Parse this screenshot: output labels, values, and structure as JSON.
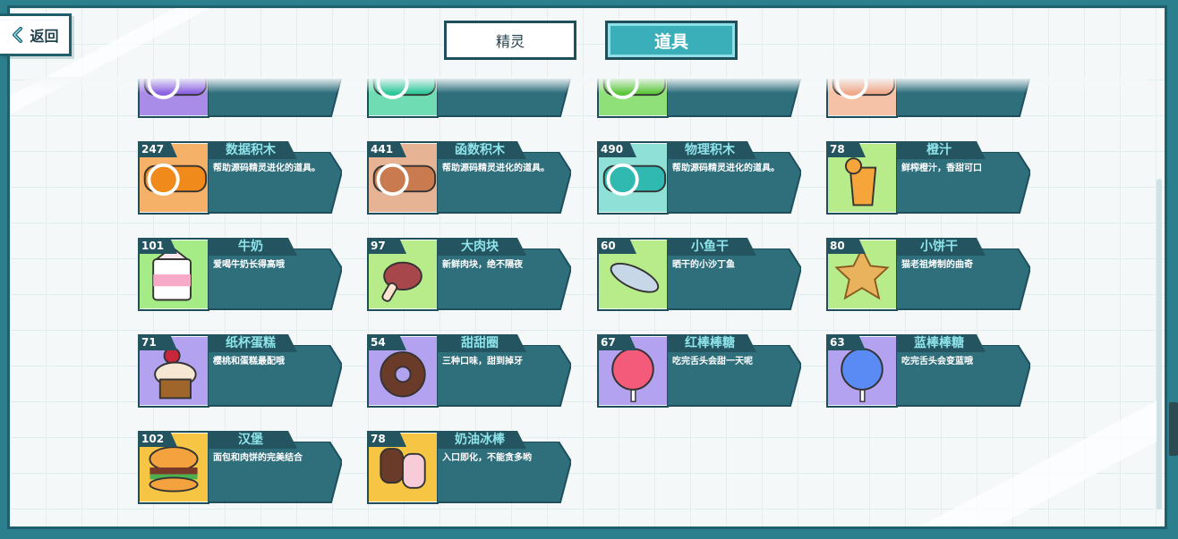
{
  "nav": {
    "back_label": "返回"
  },
  "tabs": [
    {
      "label": "精灵",
      "active": false
    },
    {
      "label": "道具",
      "active": true
    }
  ],
  "colors": {
    "accent": "#3aaeb9",
    "panel": "#2f6f7c",
    "name": "#8fe4ec"
  },
  "items": [
    {
      "name": "",
      "desc": "",
      "count": "",
      "icon": "sound-block-icon",
      "bg": "#a98be8"
    },
    {
      "name": "",
      "desc": "",
      "count": "",
      "icon": "pen-block-icon",
      "bg": "#6fdcb3"
    },
    {
      "name": "",
      "desc": "",
      "count": "",
      "icon": "sensing-block-icon",
      "bg": "#8fe078"
    },
    {
      "name": "",
      "desc": "",
      "count": "",
      "icon": "operator-block-icon",
      "bg": "#f5c2a7"
    },
    {
      "name": "数据积木",
      "desc": "帮助源码精灵进化的道具。",
      "count": "247",
      "icon": "data-block-icon",
      "bg": "#f5b168"
    },
    {
      "name": "函数积木",
      "desc": "帮助源码精灵进化的道具。",
      "count": "441",
      "icon": "procedure-block-icon",
      "bg": "#e6b394"
    },
    {
      "name": "物理积木",
      "desc": "帮助源码精灵进化的道具。",
      "count": "490",
      "icon": "physics-block-icon",
      "bg": "#8fe0d6"
    },
    {
      "name": "橙汁",
      "desc": "鲜榨橙汁，香甜可口",
      "count": "78",
      "icon": "orange-juice-icon",
      "bg": "#b8ec8a"
    },
    {
      "name": "牛奶",
      "desc": "爱喝牛奶长得高哦",
      "count": "101",
      "icon": "milk-carton-icon",
      "bg": "#a6ec86"
    },
    {
      "name": "大肉块",
      "desc": "新鲜肉块，绝不隔夜",
      "count": "97",
      "icon": "meat-icon",
      "bg": "#b8ec8a"
    },
    {
      "name": "小鱼干",
      "desc": "晒干的小沙丁鱼",
      "count": "60",
      "icon": "dried-fish-icon",
      "bg": "#b8ec8a"
    },
    {
      "name": "小饼干",
      "desc": "猫老祖烤制的曲奇",
      "count": "80",
      "icon": "cookie-icon",
      "bg": "#b8ec8a"
    },
    {
      "name": "纸杯蛋糕",
      "desc": "樱桃和蛋糕最配哦",
      "count": "71",
      "icon": "cupcake-icon",
      "bg": "#b3a2f0"
    },
    {
      "name": "甜甜圈",
      "desc": "三种口味，甜到掉牙",
      "count": "54",
      "icon": "donut-icon",
      "bg": "#b3a2f0"
    },
    {
      "name": "红棒棒糖",
      "desc": "吃完舌头会甜一天呢",
      "count": "67",
      "icon": "red-lollipop-icon",
      "bg": "#b3a2f0"
    },
    {
      "name": "蓝棒棒糖",
      "desc": "吃完舌头会变蓝哦",
      "count": "63",
      "icon": "blue-lollipop-icon",
      "bg": "#b3a2f0"
    },
    {
      "name": "汉堡",
      "desc": "面包和肉饼的完美结合",
      "count": "102",
      "icon": "hamburger-icon",
      "bg": "#f7c544"
    },
    {
      "name": "奶油冰棒",
      "desc": "入口即化，不能贪多哟",
      "count": "78",
      "icon": "ice-cream-bar-icon",
      "bg": "#f7c544"
    }
  ]
}
